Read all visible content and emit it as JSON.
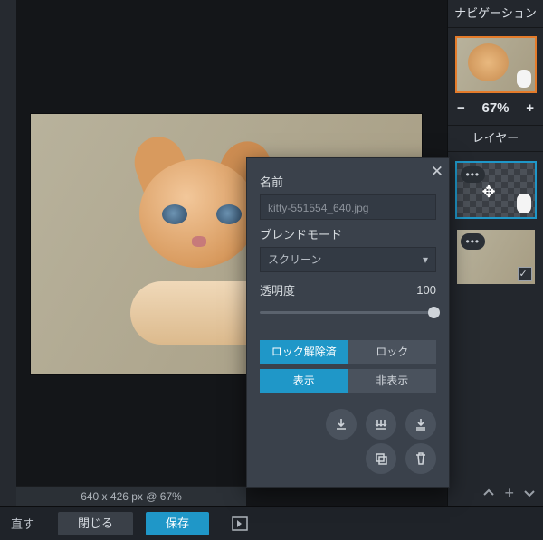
{
  "right_panel": {
    "nav_title": "ナビゲーション",
    "zoom_minus": "−",
    "zoom_value": "67%",
    "zoom_plus": "+",
    "layers_title": "レイヤー"
  },
  "canvas_info": "640 x 426 px @ 67%",
  "bottom": {
    "undo_label": "直す",
    "close_label": "閉じる",
    "save_label": "保存"
  },
  "popup": {
    "name_label": "名前",
    "name_value": "kitty-551554_640.jpg",
    "blend_label": "ブレンドモード",
    "blend_value": "スクリーン",
    "opacity_label": "透明度",
    "opacity_value": "100",
    "unlocked": "ロック解除済",
    "locked": "ロック",
    "show": "表示",
    "hide": "非表示"
  }
}
